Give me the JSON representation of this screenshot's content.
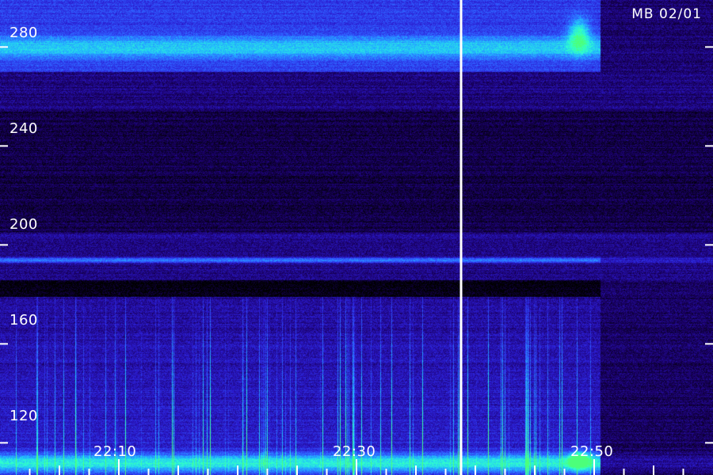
{
  "chart_data": {
    "type": "heatmap",
    "title": "MB 02/01",
    "xlabel": "",
    "ylabel": "",
    "y_ticks": [
      280,
      240,
      200,
      160,
      120
    ],
    "y_labels": [
      "280",
      "240",
      "200",
      "160",
      "120"
    ],
    "ylim": [
      107,
      299
    ],
    "x_major_ticks": [
      "22:10",
      "22:30",
      "22:50"
    ],
    "xlim_minutes_after_22_00": [
      -0.0,
      60.0
    ],
    "x_major_tick_minutes": [
      10,
      30,
      50
    ],
    "x_minor_tick_minutes": [
      5,
      10,
      15,
      20,
      25,
      30,
      35,
      40,
      45,
      50,
      55
    ],
    "vertical_marker_minutes": 38.8,
    "band_features": [
      {
        "name": "upper emission band",
        "y_center": 280,
        "relative_intensity": 0.85
      },
      {
        "name": "line near 195",
        "y_center": 194,
        "relative_intensity": 0.7
      },
      {
        "name": "dark gap",
        "y_center": 183,
        "relative_intensity": 0.0
      },
      {
        "name": "lower emission band",
        "y_center": 112,
        "relative_intensity": 0.95
      }
    ],
    "colormap": [
      "#000000",
      "#1a0066",
      "#2b1bd0",
      "#2f5cff",
      "#22b8ff",
      "#2effd0",
      "#4cff7a"
    ],
    "grid": false
  }
}
